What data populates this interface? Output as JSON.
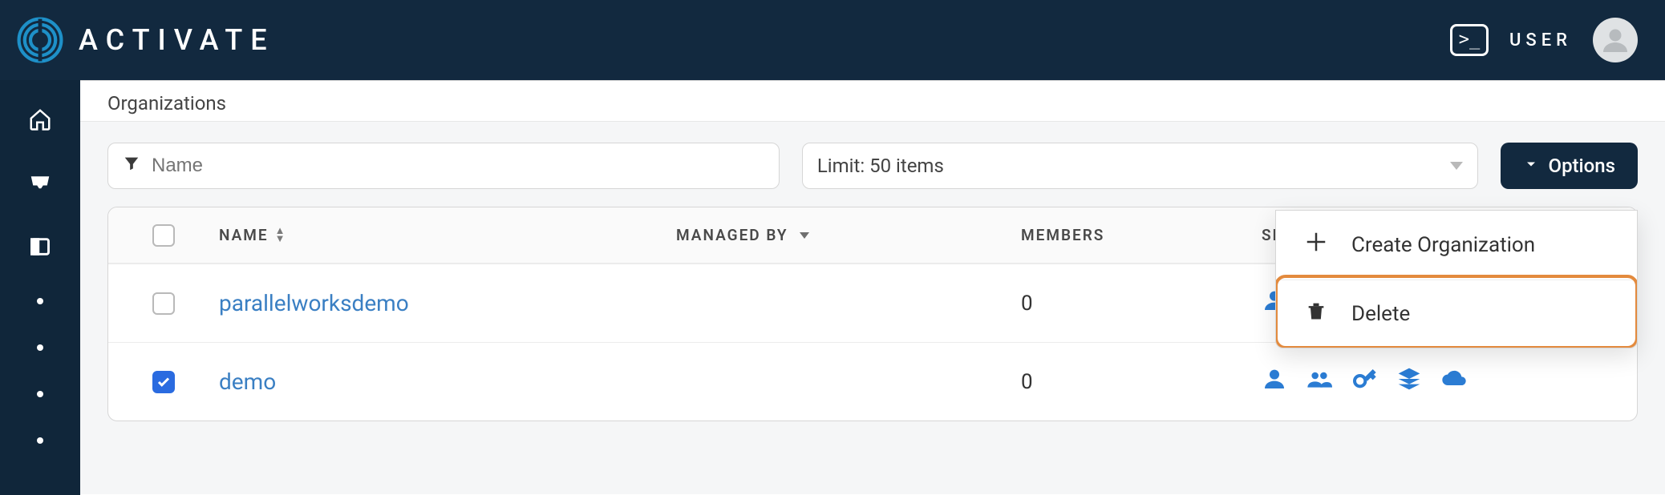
{
  "brand": {
    "name": "ACTIVATE",
    "user_label": "USER"
  },
  "sidebar": {
    "icons": [
      "home",
      "inbox",
      "panel"
    ],
    "dot_count": 4
  },
  "breadcrumb": "Organizations",
  "filters": {
    "name_placeholder": "Name",
    "limit_label": "Limit: 50 items"
  },
  "options_button": {
    "label": "Options"
  },
  "options_menu": {
    "items": [
      {
        "icon": "plus",
        "label": "Create Organization"
      },
      {
        "icon": "trash",
        "label": "Delete"
      }
    ],
    "highlighted_index": 1
  },
  "table": {
    "columns": {
      "name": "NAME",
      "managed_by": "MANAGED BY",
      "members": "MEMBERS",
      "shared": "SH"
    },
    "rows": [
      {
        "checked": false,
        "name": "parallelworksdemo",
        "managed_by": "",
        "members": "0",
        "shared_icons": [
          "person"
        ]
      },
      {
        "checked": true,
        "name": "demo",
        "managed_by": "",
        "members": "0",
        "shared_icons": [
          "person",
          "group",
          "key",
          "layers",
          "cloud"
        ]
      }
    ]
  }
}
